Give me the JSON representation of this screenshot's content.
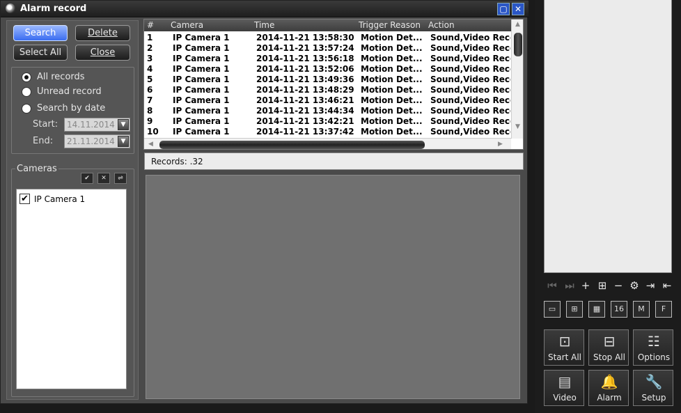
{
  "window": {
    "title": "Alarm record",
    "maximize_icon": "maximize-icon",
    "close_icon": "close-icon"
  },
  "actions": {
    "search": "Search",
    "delete": "Delete",
    "select_all": "Select All",
    "close": "Close"
  },
  "filter": {
    "all_records": "All records",
    "unread_record": "Unread record",
    "search_by_date": "Search by date",
    "start_label": "Start:",
    "start_value": "14.11.2014",
    "end_label": "End:",
    "end_value": "21.11.2014",
    "selected": "all_records"
  },
  "cameras": {
    "title": "Cameras",
    "check_all": "✔",
    "uncheck_all": "✕",
    "invert": "⇌",
    "items": [
      {
        "label": "IP Camera 1",
        "checked": true
      }
    ]
  },
  "table": {
    "headers": [
      "#",
      "Camera",
      "Time",
      "Trigger Reason",
      "Action"
    ],
    "rows": [
      [
        "1",
        "IP Camera 1",
        "2014-11-21 13:58:30",
        "Motion Det...",
        "Sound,Video Reco"
      ],
      [
        "2",
        "IP Camera 1",
        "2014-11-21 13:57:24",
        "Motion Det...",
        "Sound,Video Reco"
      ],
      [
        "3",
        "IP Camera 1",
        "2014-11-21 13:56:18",
        "Motion Det...",
        "Sound,Video Reco"
      ],
      [
        "4",
        "IP Camera 1",
        "2014-11-21 13:52:06",
        "Motion Det...",
        "Sound,Video Reco"
      ],
      [
        "5",
        "IP Camera 1",
        "2014-11-21 13:49:36",
        "Motion Det...",
        "Sound,Video Reco"
      ],
      [
        "6",
        "IP Camera 1",
        "2014-11-21 13:48:29",
        "Motion Det...",
        "Sound,Video Reco"
      ],
      [
        "7",
        "IP Camera 1",
        "2014-11-21 13:46:21",
        "Motion Det...",
        "Sound,Video Reco"
      ],
      [
        "8",
        "IP Camera 1",
        "2014-11-21 13:44:34",
        "Motion Det...",
        "Sound,Video Reco"
      ],
      [
        "9",
        "IP Camera 1",
        "2014-11-21 13:42:21",
        "Motion Det...",
        "Sound,Video Reco"
      ],
      [
        "10",
        "IP Camera 1",
        "2014-11-21 13:37:42",
        "Motion Det...",
        "Sound,Video Reco"
      ]
    ]
  },
  "status": {
    "records": "Records: .32"
  },
  "side": {
    "controls": [
      {
        "icon": "first-icon",
        "glyph": "⏮",
        "dim": true
      },
      {
        "icon": "last-icon",
        "glyph": "⏭",
        "dim": true
      },
      {
        "icon": "add-icon",
        "glyph": "+",
        "dim": false
      },
      {
        "icon": "add-group-icon",
        "glyph": "⊞",
        "dim": false
      },
      {
        "icon": "remove-icon",
        "glyph": "−",
        "dim": false
      },
      {
        "icon": "settings-icon",
        "glyph": "⚙",
        "dim": false
      },
      {
        "icon": "export-icon",
        "glyph": "⇥",
        "dim": false
      },
      {
        "icon": "import-icon",
        "glyph": "⇤",
        "dim": false
      }
    ],
    "layouts": [
      {
        "icon": "layout-1-icon",
        "glyph": "▭"
      },
      {
        "icon": "layout-4-icon",
        "glyph": "⊞"
      },
      {
        "icon": "layout-9-icon",
        "glyph": "▦"
      },
      {
        "icon": "layout-16-icon",
        "glyph": "16"
      },
      {
        "icon": "layout-m-icon",
        "glyph": "M"
      },
      {
        "icon": "fullscreen-icon",
        "glyph": "F"
      }
    ],
    "buttons": [
      {
        "label": "Start All",
        "icon": "start-all-icon",
        "glyph": "⊡"
      },
      {
        "label": "Stop All",
        "icon": "stop-all-icon",
        "glyph": "⊟"
      },
      {
        "label": "Options",
        "icon": "options-icon",
        "glyph": "☷"
      },
      {
        "label": "Video",
        "icon": "video-icon",
        "glyph": "▤"
      },
      {
        "label": "Alarm",
        "icon": "alarm-bell-icon",
        "glyph": "🔔"
      },
      {
        "label": "Setup",
        "icon": "setup-wrench-icon",
        "glyph": "🔧"
      }
    ]
  }
}
